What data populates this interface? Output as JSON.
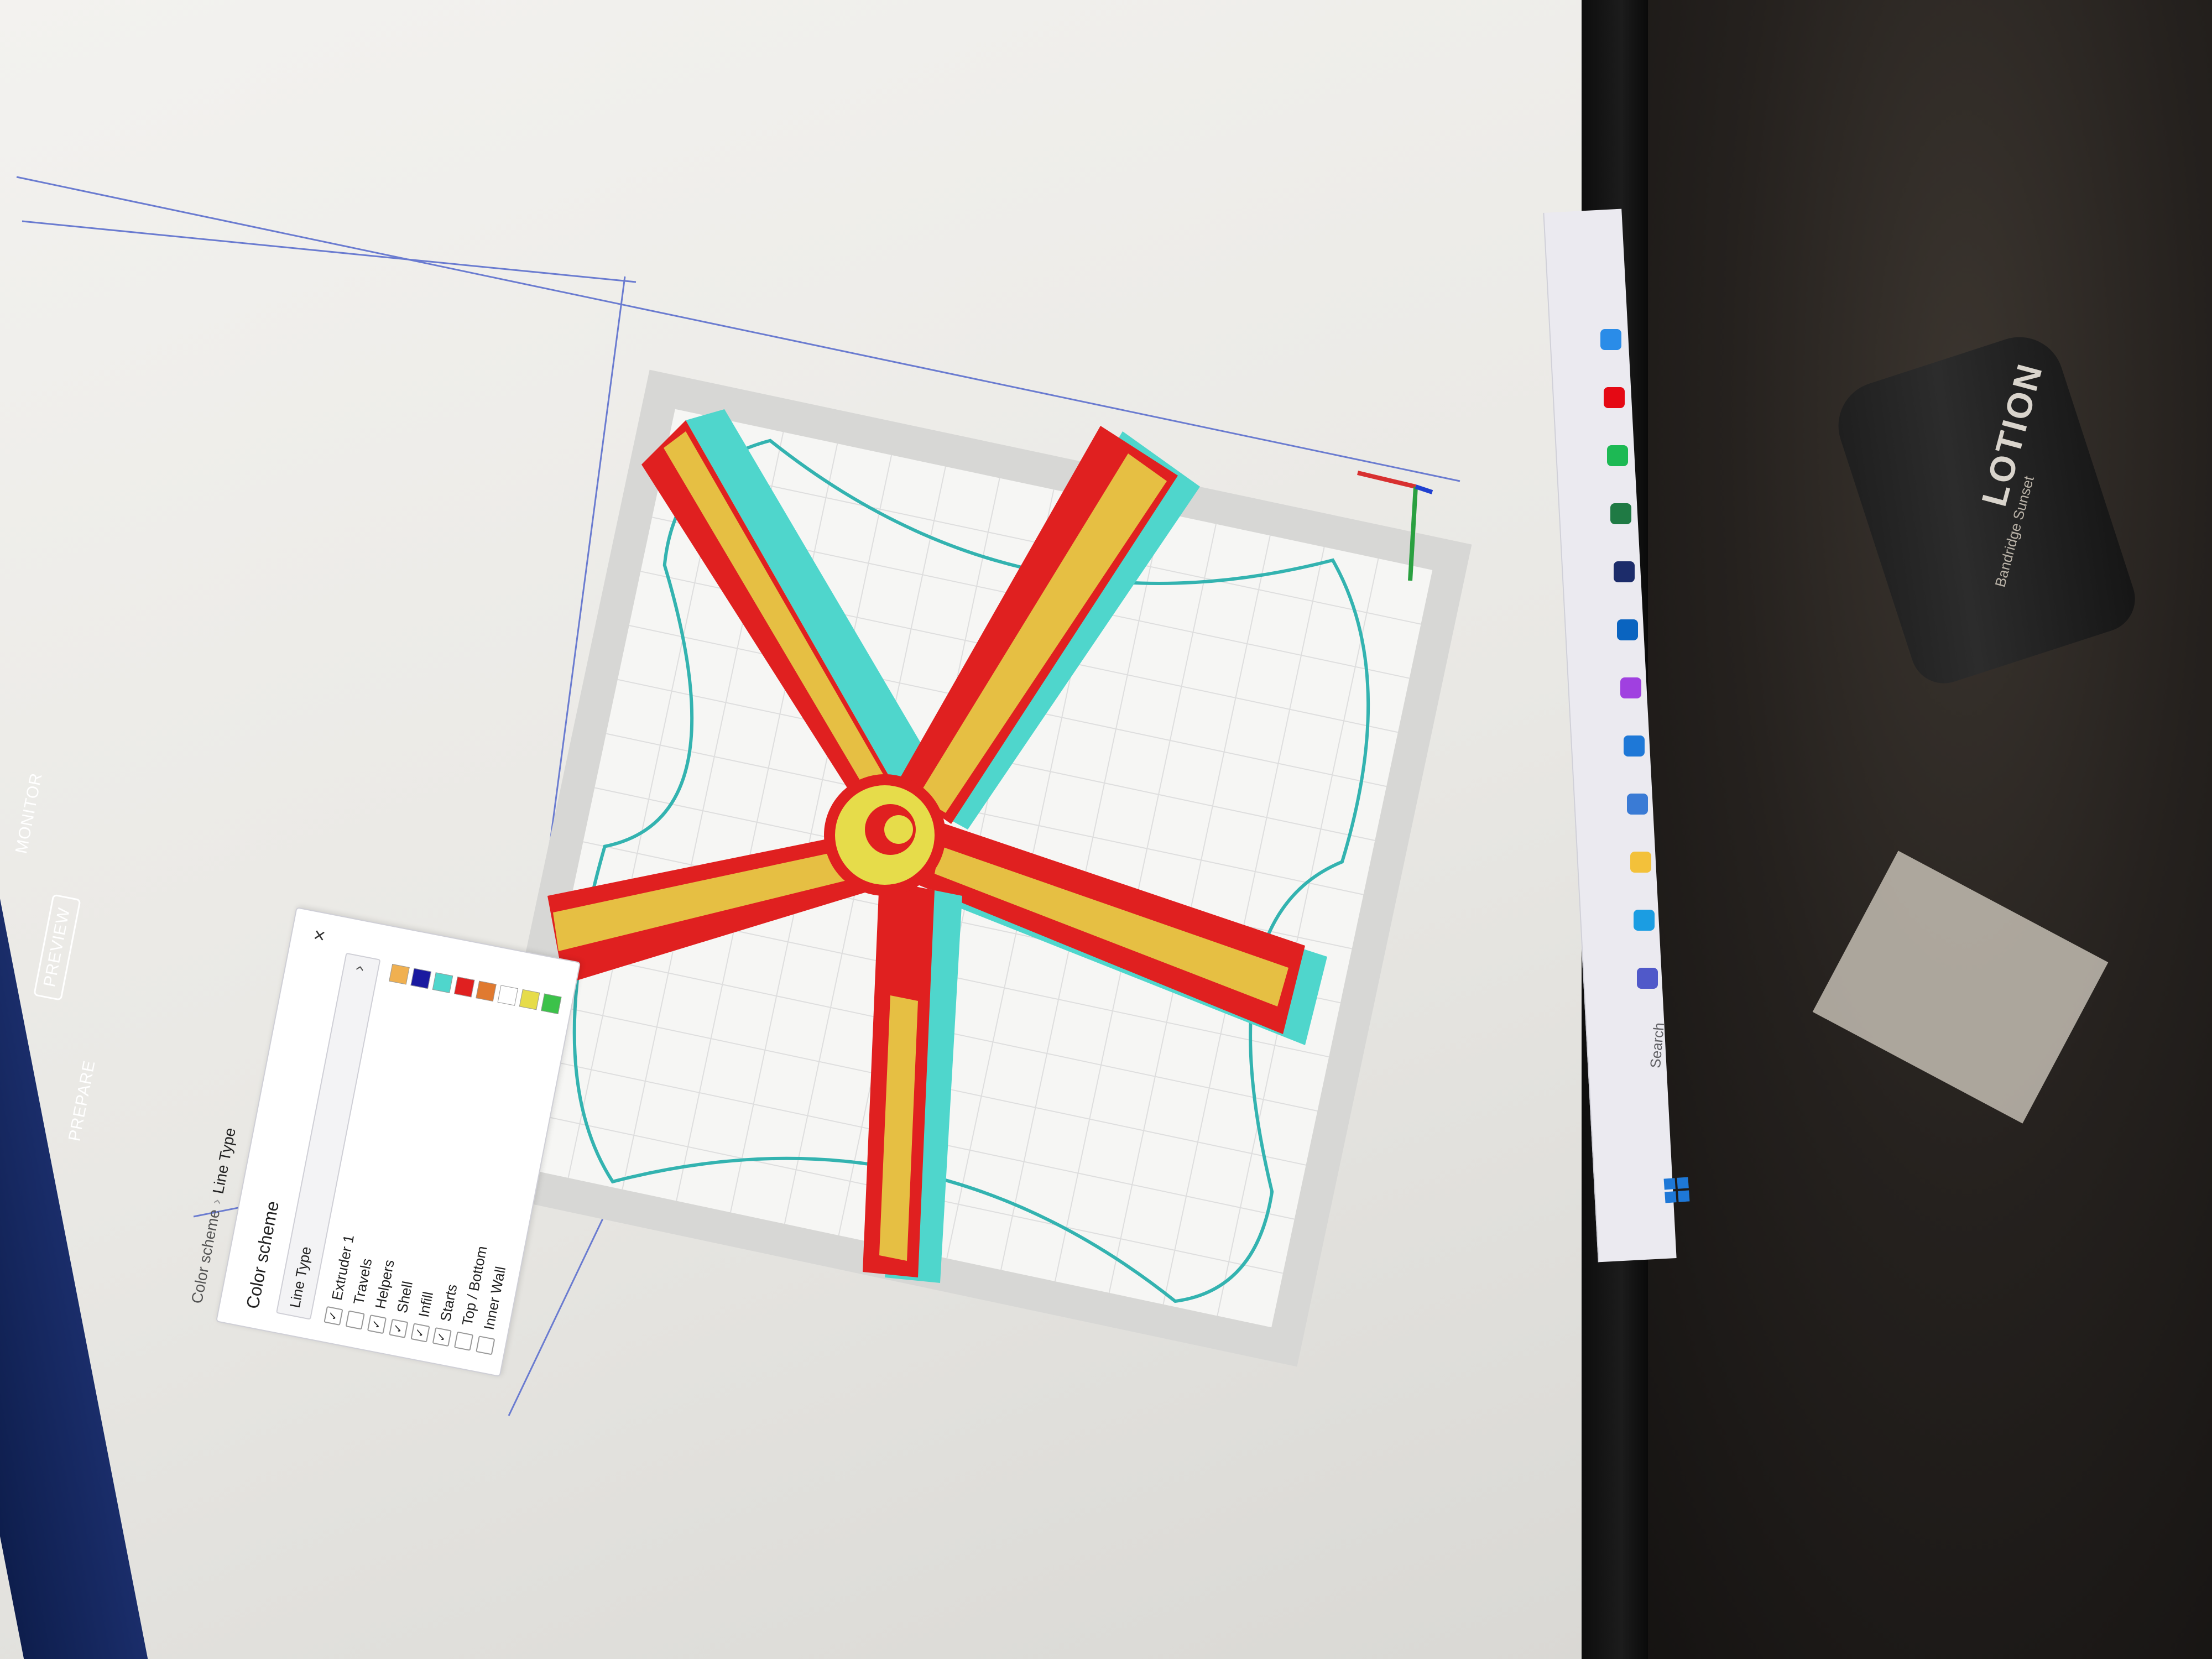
{
  "header": {
    "tabs": [
      {
        "label": "PREPARE"
      },
      {
        "label": "PREVIEW",
        "active": true
      },
      {
        "label": "MONITOR"
      }
    ]
  },
  "panel": {
    "breadcrumb_root": "Color scheme",
    "breadcrumb_current": "Line Type",
    "title": "Color scheme",
    "close_glyph": "×",
    "select_value": "Line Type",
    "select_chevron": "›",
    "rows": [
      {
        "label": "Extruder 1",
        "checked": true,
        "color": "#f0b050"
      },
      {
        "label": "Travels",
        "checked": false,
        "color": "#1a1aa0"
      },
      {
        "label": "Helpers",
        "checked": true,
        "color": "#4fd6cc"
      },
      {
        "label": "Shell",
        "checked": true,
        "color": "#e02020"
      },
      {
        "label": "Infill",
        "checked": true,
        "color": "#e07a30"
      },
      {
        "label": "Starts",
        "checked": true,
        "color": "#ffffff"
      },
      {
        "label": "Top / Bottom",
        "checked": false,
        "color": "#e6dc4a"
      },
      {
        "label": "Inner Wall",
        "checked": false,
        "color": "#3cc24a"
      }
    ]
  },
  "taskbar": {
    "search_placeholder": "Search",
    "icons": [
      "windows-start-icon",
      "search-icon",
      "teams-icon",
      "edge-icon",
      "folder-icon",
      "store-icon",
      "mail-icon",
      "messenger-icon",
      "outlook-icon",
      "app-icon",
      "excel-icon",
      "spotify-icon",
      "netflix-icon",
      "cura-icon"
    ]
  },
  "desk": {
    "bottle_text": "LOTION",
    "bottle_subtext": "Bandridge Sunset"
  },
  "colors": {
    "shell": "#e02020",
    "infill": "#e6dc4a",
    "helpers": "#4fd6cc",
    "build_plate": "#f4f4f2",
    "header": "#12235a"
  }
}
